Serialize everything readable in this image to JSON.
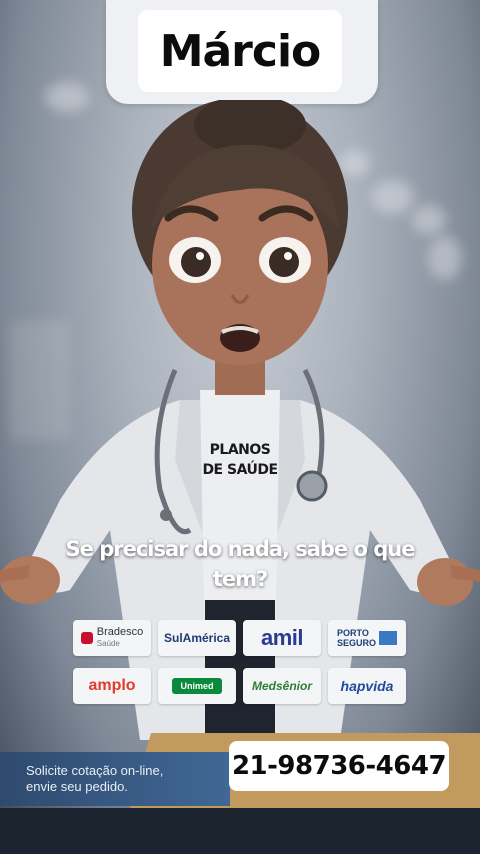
{
  "header": {
    "title": "Márcio"
  },
  "illustration": {
    "shirt_text_line1": "PLANOS",
    "shirt_text_line2": "DE SAÚDE"
  },
  "caption": {
    "text": "Se precisar do nada, sabe o que tem?"
  },
  "logos": [
    {
      "label": "Bradesco",
      "sub": "Saúde"
    },
    {
      "label": "SulAmérica"
    },
    {
      "label": "amil"
    },
    {
      "label": "PORTO SEGURO"
    },
    {
      "label": "amplo"
    },
    {
      "label": "Unimed"
    },
    {
      "label": "Medsênior"
    },
    {
      "label": "hapvida"
    }
  ],
  "cta": {
    "line1": "Solicite cotação on-line,",
    "line2": "envie seu pedido."
  },
  "phone": {
    "number": "21-98736-4647"
  },
  "colors": {
    "gold": "#c29a5d",
    "blue": "#2f4a6e",
    "amil": "#2b3a92",
    "hapvida": "#1f4aa0",
    "porto": "#1c3f77",
    "bradesco": "#c8102e",
    "amplo": "#e23a2c",
    "unimed": "#0b8a3e",
    "medsenior": "#2e7d32"
  }
}
